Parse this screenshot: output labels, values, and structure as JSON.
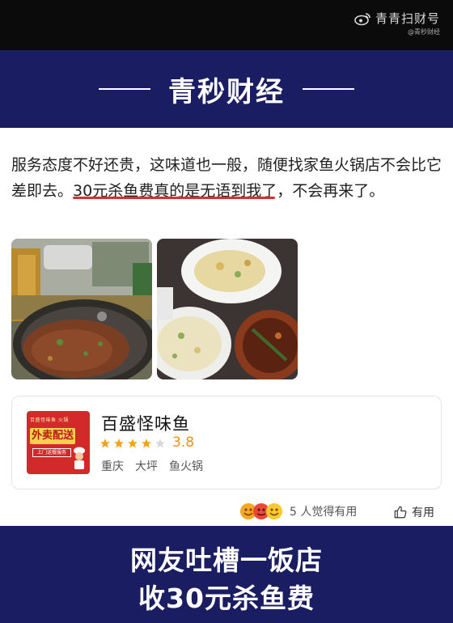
{
  "watermark": {
    "main": "青青扫财号",
    "sub": "@青秒财经"
  },
  "brand": {
    "name": "青秒财经"
  },
  "review": {
    "text_part1": "服务态度不好还贵，这味道也一般，随便找家鱼火锅店不会比它差即去。",
    "text_highlight": "30元杀鱼费真的是无语到我了",
    "text_part2": "，不会再来了。"
  },
  "photos": [
    {
      "name": "fish-hotpot-photo"
    },
    {
      "name": "fried-rice-and-dishes-photo"
    }
  ],
  "shop": {
    "logo_top": "百盛怪味鱼 火锅",
    "logo_main": "外卖配送",
    "logo_sub": "上门送餐服务",
    "name": "百盛怪味鱼",
    "stars_filled": 4,
    "stars_total": 5,
    "rating": "3.8",
    "tags": [
      "重庆",
      "大坪",
      "鱼火锅"
    ]
  },
  "feedback": {
    "helpful_count": "5 人觉得有用",
    "helpful_button": "有用"
  },
  "caption": {
    "line1": "网友吐槽一饭店",
    "line2": "收30元杀鱼费"
  },
  "colors": {
    "navy": "#1b1d63",
    "highlight_underline": "#d7312b",
    "rating": "#ef8f1e",
    "logo_red": "#d22a2a"
  },
  "icons": [
    "weibo-icon",
    "star-icon",
    "reaction-emoji-icons",
    "thumbs-up-icon"
  ]
}
